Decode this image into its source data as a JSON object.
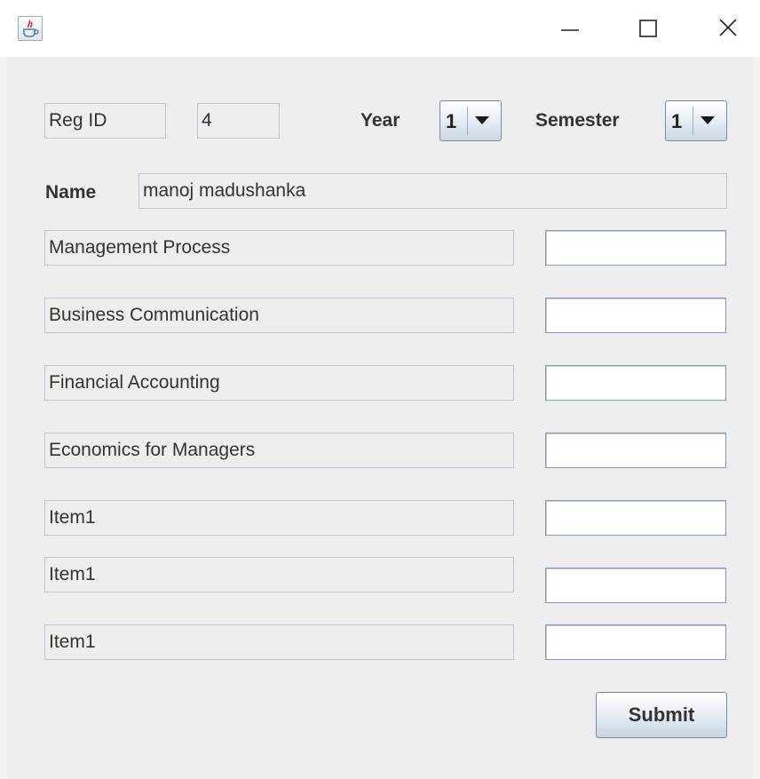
{
  "window": {
    "app_icon": "java-cup-icon",
    "controls": [
      "minimize-icon",
      "maximize-icon",
      "close-icon"
    ]
  },
  "form": {
    "reg_id_label": "Reg ID",
    "reg_id_value": "4",
    "year_label": "Year",
    "year_value": "1",
    "semester_label": "Semester",
    "semester_value": "1",
    "name_label": "Name",
    "name_value": "manoj madushanka",
    "subjects": [
      {
        "name": "Management Process",
        "mark": ""
      },
      {
        "name": "Business Communication",
        "mark": ""
      },
      {
        "name": "Financial Accounting",
        "mark": ""
      },
      {
        "name": "Economics for Managers",
        "mark": ""
      },
      {
        "name": "Item1",
        "mark": ""
      },
      {
        "name": "Item1",
        "mark": ""
      },
      {
        "name": "Item1",
        "mark": ""
      }
    ],
    "submit_label": "Submit"
  }
}
